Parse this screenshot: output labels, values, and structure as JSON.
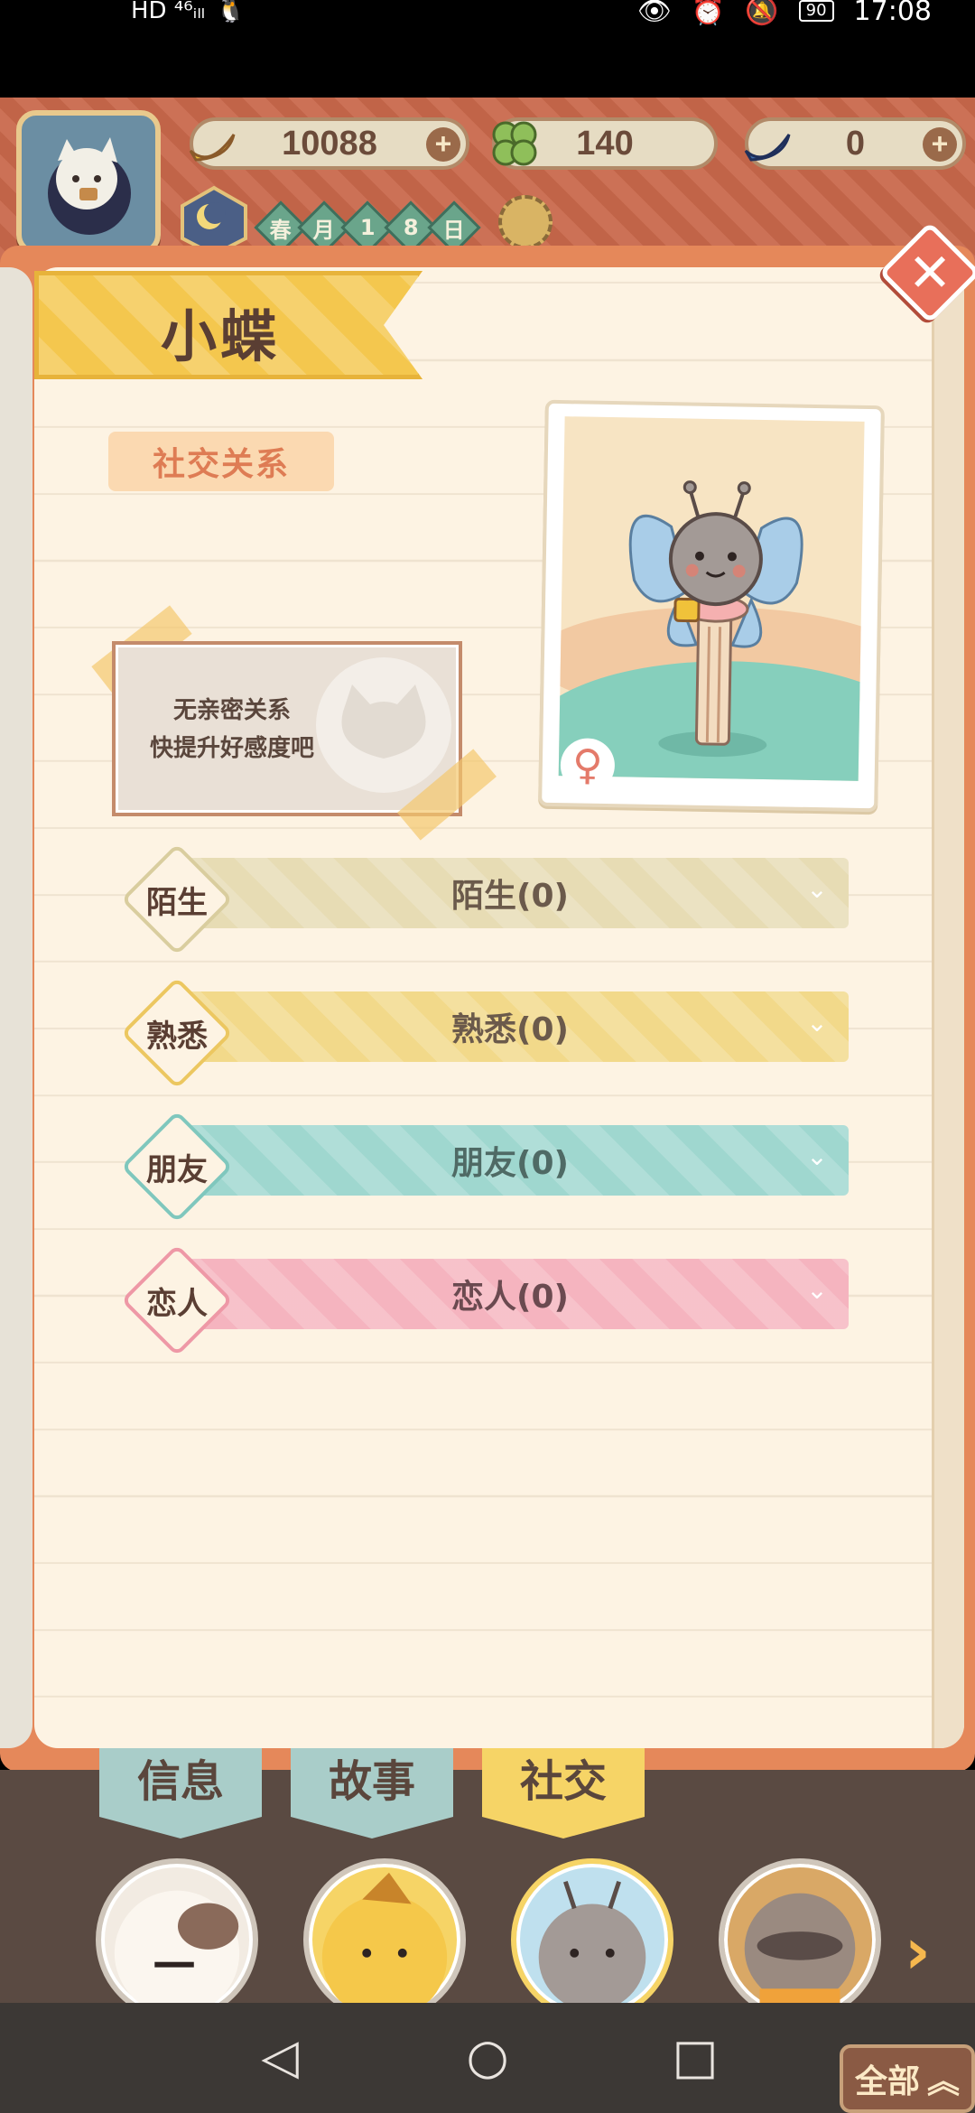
{
  "status_bar": {
    "left_icons": "HD ⁴⁶ᵢₗₗ",
    "battery": "90",
    "time": "17:08"
  },
  "resources": {
    "banana": {
      "value": "10088",
      "icon": "banana-icon"
    },
    "clover": {
      "value": "140",
      "icon": "clover-icon"
    },
    "blue_banana": {
      "value": "0",
      "icon": "blue-banana-icon"
    }
  },
  "date": {
    "cells": [
      "春",
      "月",
      "1",
      "8",
      "日"
    ]
  },
  "character": {
    "name": "小蝶"
  },
  "social": {
    "tag": "社交关系",
    "note_line1": "无亲密关系",
    "note_line2": "快提升好感度吧"
  },
  "relations": [
    {
      "badge": "陌生",
      "label": "陌生(0)",
      "bar_color": "#e7dcb4",
      "badge_border": "#d9cd9e",
      "text_color": "#6b5a4b"
    },
    {
      "badge": "熟悉",
      "label": "熟悉(0)",
      "bar_color": "#f2d98a",
      "badge_border": "#ecc760",
      "text_color": "#6b5a4b"
    },
    {
      "badge": "朋友",
      "label": "朋友(0)",
      "bar_color": "#9fd7cf",
      "badge_border": "#7fc7bd",
      "text_color": "#4f6a65"
    },
    {
      "badge": "恋人",
      "label": "恋人(0)",
      "bar_color": "#f5b4bf",
      "badge_border": "#ee98a6",
      "text_color": "#6b4a50"
    }
  ],
  "tabs": [
    "信息",
    "故事",
    "社交"
  ],
  "bottom": {
    "all_label": "全部"
  }
}
